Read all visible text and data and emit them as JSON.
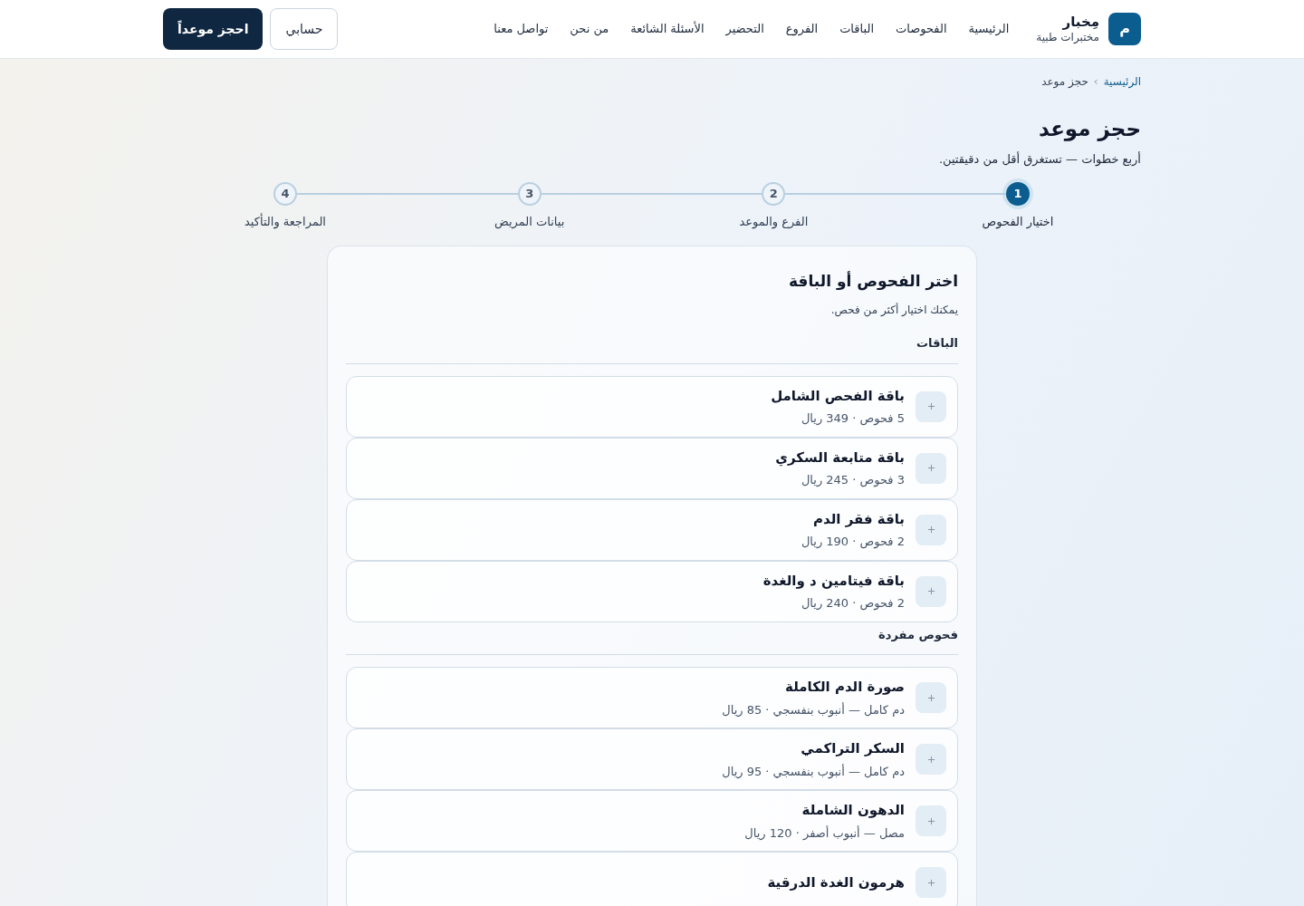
{
  "brand": {
    "mark": "م",
    "name": "مِخبار",
    "tagline": "مختبرات طبية"
  },
  "nav": [
    {
      "label": "الرئيسية"
    },
    {
      "label": "الفحوصات"
    },
    {
      "label": "الباقات"
    },
    {
      "label": "الفروع"
    },
    {
      "label": "التحضير"
    },
    {
      "label": "الأسئلة الشائعة"
    },
    {
      "label": "من نحن"
    },
    {
      "label": "تواصل معنا"
    }
  ],
  "header_buttons": [
    {
      "label": "حسابي",
      "kind": "outline"
    },
    {
      "label": "احجز موعداً",
      "kind": "primary"
    }
  ],
  "breadcrumb": [
    {
      "label": "الرئيسية",
      "kind": "link"
    },
    {
      "label": "حجز موعد",
      "kind": "current"
    }
  ],
  "breadcrumb_separator": "›",
  "page_title": "حجز موعد",
  "page_subtitle": "أربع خطوات — تستغرق أقل من دقيقتين.",
  "steps": [
    {
      "number": "1",
      "label": "اختيار الفحوص",
      "selected": true
    },
    {
      "number": "2",
      "label": "الفرع والموعد",
      "selected": false
    },
    {
      "number": "3",
      "label": "بيانات المريض",
      "selected": false
    },
    {
      "number": "4",
      "label": "المراجعة والتأكيد",
      "selected": false
    }
  ],
  "panel": {
    "title": "اختر الفحوص أو الباقة",
    "hint": "يمكنك اختيار أكثر من فحص.",
    "sections": [
      {
        "heading": "الباقات",
        "items": [
          {
            "name": "باقة الفحص الشامل",
            "details": "5 فحوص · 349 ريال"
          },
          {
            "name": "باقة متابعة السكري",
            "details": "3 فحوص · 245 ريال"
          },
          {
            "name": "باقة فقر الدم",
            "details": "2 فحوص · 190 ريال"
          },
          {
            "name": "باقة فيتامين د والغدة",
            "details": "2 فحوص · 240 ريال"
          }
        ]
      },
      {
        "heading": "فحوص مفردة",
        "items": [
          {
            "name": "صورة الدم الكاملة",
            "details": "دم كامل — أنبوب بنفسجي · 85 ريال"
          },
          {
            "name": "السكر التراكمي",
            "details": "دم كامل — أنبوب بنفسجي · 95 ريال"
          },
          {
            "name": "الدهون الشاملة",
            "details": "مصل — أنبوب أصفر · 120 ريال"
          },
          {
            "name": "هرمون الغدة الدرقية"
          }
        ]
      }
    ]
  }
}
